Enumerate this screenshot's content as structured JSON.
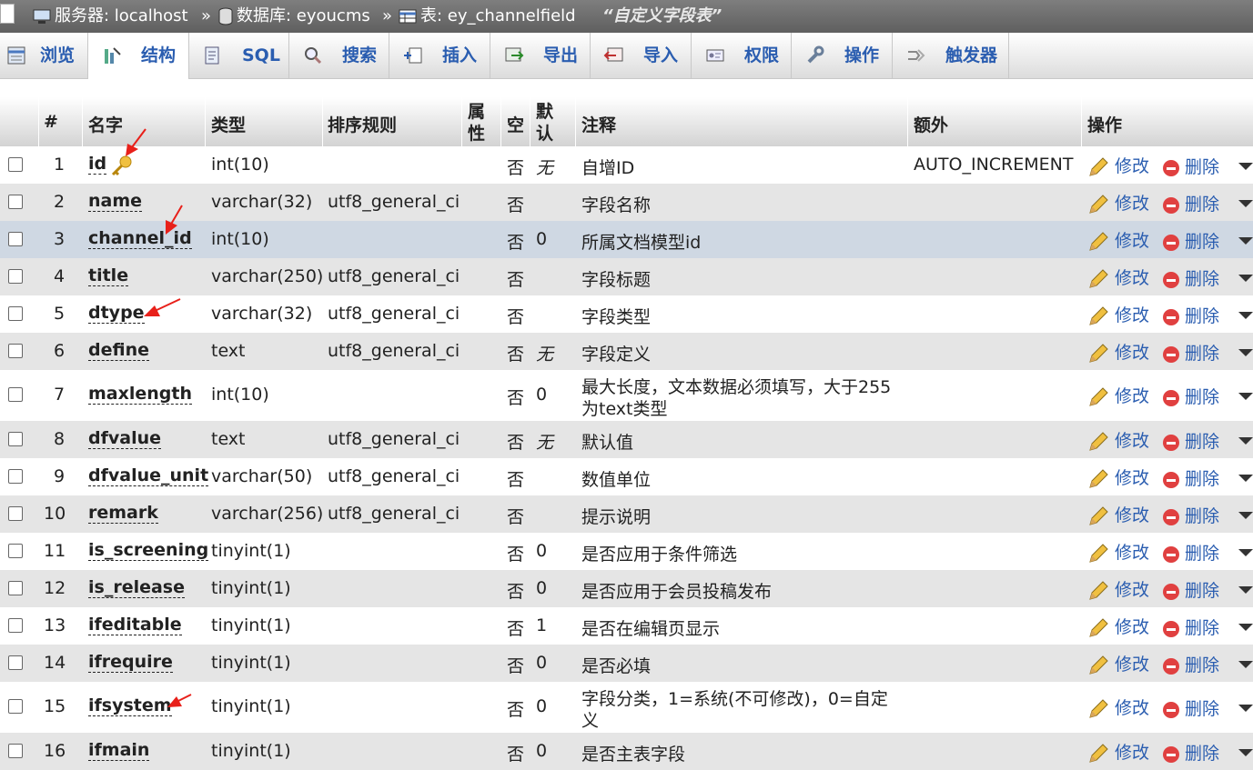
{
  "breadcrumb": {
    "server_label": "服务器: localhost",
    "database_label": "数据库: eyoucms",
    "table_label": "表: ey_channelfield",
    "table_comment": "“自定义字段表”",
    "separator": "»"
  },
  "tabs": [
    {
      "label": "浏览",
      "icon": "browse-icon"
    },
    {
      "label": "结构",
      "icon": "structure-icon",
      "active": true
    },
    {
      "label": "SQL",
      "icon": "sql-icon"
    },
    {
      "label": "搜索",
      "icon": "search-icon"
    },
    {
      "label": "插入",
      "icon": "insert-icon"
    },
    {
      "label": "导出",
      "icon": "export-icon"
    },
    {
      "label": "导入",
      "icon": "import-icon"
    },
    {
      "label": "权限",
      "icon": "privileges-icon"
    },
    {
      "label": "操作",
      "icon": "operations-icon"
    },
    {
      "label": "触发器",
      "icon": "triggers-icon"
    }
  ],
  "columns": {
    "num": "#",
    "name": "名字",
    "type": "类型",
    "collation": "排序规则",
    "attributes": "属性",
    "null": "空",
    "default": "默认",
    "comment": "注释",
    "extra": "额外",
    "action": "操作"
  },
  "actions": {
    "edit": "修改",
    "delete": "删除"
  },
  "rows": [
    {
      "num": "1",
      "name": "id",
      "type": "int(10)",
      "collation": "",
      "null": "否",
      "default": "无",
      "default_italic": true,
      "comment": "自增ID",
      "extra": "AUTO_INCREMENT",
      "primary_key": true
    },
    {
      "num": "2",
      "name": "name",
      "type": "varchar(32)",
      "collation": "utf8_general_ci",
      "null": "否",
      "default": "",
      "comment": "字段名称",
      "extra": ""
    },
    {
      "num": "3",
      "name": "channel_id",
      "type": "int(10)",
      "collation": "",
      "null": "否",
      "default": "0",
      "comment": "所属文档模型id",
      "extra": "",
      "highlighted": true
    },
    {
      "num": "4",
      "name": "title",
      "type": "varchar(250)",
      "collation": "utf8_general_ci",
      "null": "否",
      "default": "",
      "comment": "字段标题",
      "extra": ""
    },
    {
      "num": "5",
      "name": "dtype",
      "type": "varchar(32)",
      "collation": "utf8_general_ci",
      "null": "否",
      "default": "",
      "comment": "字段类型",
      "extra": ""
    },
    {
      "num": "6",
      "name": "define",
      "type": "text",
      "collation": "utf8_general_ci",
      "null": "否",
      "default": "无",
      "default_italic": true,
      "comment": "字段定义",
      "extra": ""
    },
    {
      "num": "7",
      "name": "maxlength",
      "type": "int(10)",
      "collation": "",
      "null": "否",
      "default": "0",
      "comment": "最大长度，文本数据必须填写，大于255",
      "comment2": "为text类型",
      "extra": ""
    },
    {
      "num": "8",
      "name": "dfvalue",
      "type": "text",
      "collation": "utf8_general_ci",
      "null": "否",
      "default": "无",
      "default_italic": true,
      "comment": "默认值",
      "extra": ""
    },
    {
      "num": "9",
      "name": "dfvalue_unit",
      "type": "varchar(50)",
      "collation": "utf8_general_ci",
      "null": "否",
      "default": "",
      "comment": "数值单位",
      "extra": ""
    },
    {
      "num": "10",
      "name": "remark",
      "type": "varchar(256)",
      "collation": "utf8_general_ci",
      "null": "否",
      "default": "",
      "comment": "提示说明",
      "extra": ""
    },
    {
      "num": "11",
      "name": "is_screening",
      "type": "tinyint(1)",
      "collation": "",
      "null": "否",
      "default": "0",
      "comment": "是否应用于条件筛选",
      "extra": ""
    },
    {
      "num": "12",
      "name": "is_release",
      "type": "tinyint(1)",
      "collation": "",
      "null": "否",
      "default": "0",
      "comment": "是否应用于会员投稿发布",
      "extra": ""
    },
    {
      "num": "13",
      "name": "ifeditable",
      "type": "tinyint(1)",
      "collation": "",
      "null": "否",
      "default": "1",
      "comment": "是否在编辑页显示",
      "extra": ""
    },
    {
      "num": "14",
      "name": "ifrequire",
      "type": "tinyint(1)",
      "collation": "",
      "null": "否",
      "default": "0",
      "comment": "是否必填",
      "extra": ""
    },
    {
      "num": "15",
      "name": "ifsystem",
      "type": "tinyint(1)",
      "collation": "",
      "null": "否",
      "default": "0",
      "comment": "字段分类，1=系统(不可修改)，0=自定",
      "comment2": "义",
      "extra": ""
    },
    {
      "num": "16",
      "name": "ifmain",
      "type": "tinyint(1)",
      "collation": "",
      "null": "否",
      "default": "0",
      "comment": "是否主表字段",
      "extra": ""
    }
  ],
  "colors": {
    "link": "#2a5db0",
    "highlight_row": "#cfd8e3",
    "even_row": "#e5e5e5",
    "annotation_arrow": "#e8201a"
  }
}
